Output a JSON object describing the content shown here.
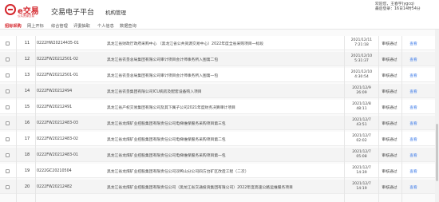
{
  "header": {
    "logo_text": "e交易",
    "logo_sub": "公共资源交易",
    "title": "交易电子平台",
    "subtitle": "机构管理",
    "welcome": "欢迎您，",
    "user_name": "王春宇(ygcq)",
    "last_login_label": "最后登录：",
    "last_login_time": "16日14时54分"
  },
  "nav": {
    "items": [
      {
        "label": "招标采购",
        "active": true
      },
      {
        "label": "网上开标",
        "active": false
      },
      {
        "label": "综合管理",
        "active": false
      },
      {
        "label": "评委抽取",
        "active": false
      },
      {
        "label": "个人信息",
        "active": false
      },
      {
        "label": "数据查询",
        "active": false
      }
    ]
  },
  "table": {
    "rows": [
      {
        "num": "11",
        "code": "0222HW20214435-01",
        "desc": "黑龙江省财政厅政府采购中心 （黑龙江省公共资源交易中心）2022年度全省采购项目一标段",
        "date": "2021/12/11",
        "time": "7:21:18",
        "status": "审核通过",
        "action": "查看"
      },
      {
        "num": "12",
        "code": "0222FW20212501-02",
        "desc": "黑龙江省农垦总局集团有限公司审计项目会计师事务所入围第二包",
        "date": "2021/12/10",
        "time": "5:31:37",
        "status": "审核通过",
        "action": "查看"
      },
      {
        "num": "13",
        "code": "0222FW20212501-01",
        "desc": "黑龙江省农垦总局集团有限公司审计项目会计师事务所入围第一包",
        "date": "2021/12/10",
        "time": "4:30:54",
        "status": "审核通过",
        "action": "查看"
      },
      {
        "num": "14",
        "code": "0222FW20212494",
        "desc": "黑龙江省农垦集团有限公司ICU病房及配套设备购入项目",
        "date": "2021/12/9",
        "time": "26:09",
        "status": "审核通过",
        "action": "查看"
      },
      {
        "num": "15",
        "code": "0222FW20212491",
        "desc": "黑龙江省产权交易集团有限公司及其下属子公司2021年度财务决算审计项目",
        "date": "2021/12/8",
        "time": "48:11",
        "status": "审核通过",
        "action": "查看"
      },
      {
        "num": "16",
        "code": "0222FW20212483-03",
        "desc": "黑龙江省龙煤矿业控股集团有限责任公司电梯维保服务采购项目第三包",
        "date": "2021/12/7",
        "time": "43:51",
        "status": "审核通过",
        "action": "查看"
      },
      {
        "num": "17",
        "code": "0222FW20212483-02",
        "desc": "黑龙江省龙煤矿业控股集团有限责任公司电梯维保服务采购项目第二包",
        "date": "2021/12/7",
        "time": "02:02",
        "status": "审核通过",
        "action": "查看"
      },
      {
        "num": "18",
        "code": "0222FW20212483-01",
        "desc": "黑龙江省龙煤矿业控股集团有限责任公司电梯维保服务采购项目第一包",
        "date": "2021/12/7",
        "time": "05:08",
        "status": "审核通过",
        "action": "查看"
      },
      {
        "num": "19",
        "code": "0222GC20210504",
        "desc": "黑龙江省龙煤矿业控股集团有限责任公司双鸭山分公司四方台矿区改造工程（二次）",
        "date": "2021/12/7",
        "time": "14:39",
        "status": "审核通过",
        "action": "查看"
      },
      {
        "num": "20",
        "code": "0222FW20212482",
        "desc": "黑龙江省龙煤矿业控股集团有限责任公司（黑龙江省交通投资集团有限公司）2022年度高速公路运维服务项目",
        "date": "2021/12/7",
        "time": "14:19",
        "status": "审核通过",
        "action": "查看"
      }
    ]
  }
}
